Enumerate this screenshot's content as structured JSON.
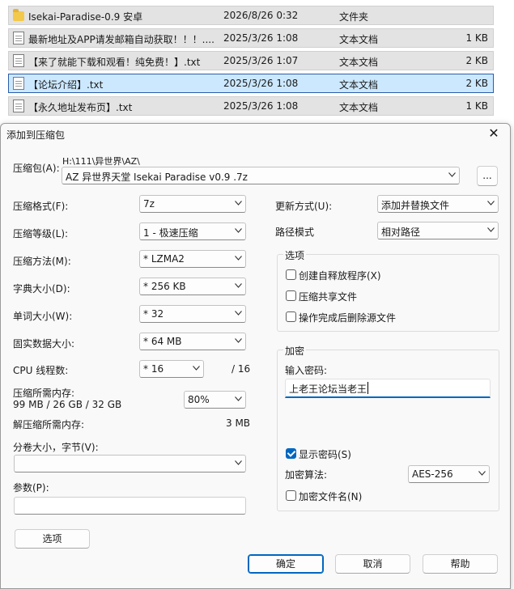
{
  "files": [
    {
      "name": "Isekai-Paradise-0.9 安卓",
      "date": "2026/8/26 0:32",
      "type": "文件夹",
      "size": "",
      "icon": "folder-icon",
      "selected": false
    },
    {
      "name": "最新地址及APP请发邮箱自动获取！！！....",
      "date": "2025/3/26 1:08",
      "type": "文本文档",
      "size": "1 KB",
      "icon": "text-document-icon",
      "selected": false
    },
    {
      "name": "【来了就能下载和观看！纯免费！】.txt",
      "date": "2025/3/26 1:07",
      "type": "文本文档",
      "size": "2 KB",
      "icon": "text-document-icon",
      "selected": false
    },
    {
      "name": "【论坛介绍】.txt",
      "date": "2025/3/26 1:08",
      "type": "文本文档",
      "size": "2 KB",
      "icon": "text-document-icon",
      "selected": true
    },
    {
      "name": "【永久地址发布页】.txt",
      "date": "2025/3/26 1:08",
      "type": "文本文档",
      "size": "1 KB",
      "icon": "text-document-icon",
      "selected": false
    }
  ],
  "dialog": {
    "title": "添加到压缩包",
    "close_glyph": "✕",
    "archive": {
      "label": "压缩包(A):",
      "path": "H:\\111\\异世界\\AZ\\",
      "value": "AZ 异世界天堂 Isekai Paradise v0.9 .7z",
      "browse_label": "..."
    },
    "format": {
      "label": "压缩格式(F):",
      "value": "7z"
    },
    "level": {
      "label": "压缩等级(L):",
      "value": "1 - 极速压缩"
    },
    "method": {
      "label": "压缩方法(M):",
      "value": "*  LZMA2"
    },
    "dict": {
      "label": "字典大小(D):",
      "value": "*  256 KB"
    },
    "word": {
      "label": "单词大小(W):",
      "value": "*  32"
    },
    "solid": {
      "label": "固实数据大小:",
      "value": "*  64 MB"
    },
    "cpu": {
      "label": "CPU 线程数:",
      "value": "*  16",
      "max": "/ 16"
    },
    "mem_compress": {
      "label": "压缩所需内存:",
      "detail": "99 MB / 26 GB / 32 GB",
      "value": "80%"
    },
    "mem_decompress": {
      "label": "解压缩所需内存:",
      "value": "3 MB"
    },
    "split": {
      "label": "分卷大小，字节(V):",
      "value": ""
    },
    "params": {
      "label": "参数(P):",
      "value": ""
    },
    "options_button": "选项",
    "update": {
      "label": "更新方式(U):",
      "value": "添加并替换文件"
    },
    "pathmode": {
      "label": "路径模式",
      "value": "相对路径"
    },
    "options_group": {
      "title": "选项",
      "sfx": {
        "label": "创建自释放程序(X)",
        "checked": false
      },
      "shared": {
        "label": "压缩共享文件",
        "checked": false
      },
      "delete": {
        "label": "操作完成后删除源文件",
        "checked": false
      }
    },
    "encryption": {
      "title": "加密",
      "password_label": "输入密码:",
      "password_value": "上老王论坛当老王",
      "show_password": {
        "label": "显示密码(S)",
        "checked": true
      },
      "method_label": "加密算法:",
      "method_value": "AES-256",
      "encrypt_names": {
        "label": "加密文件名(N)",
        "checked": false
      }
    },
    "ok_button": "确定",
    "cancel_button": "取消",
    "help_button": "帮助"
  },
  "colors": {
    "accent": "#0067c0",
    "selection": "#cce8ff",
    "row": "#e3e3e3"
  }
}
